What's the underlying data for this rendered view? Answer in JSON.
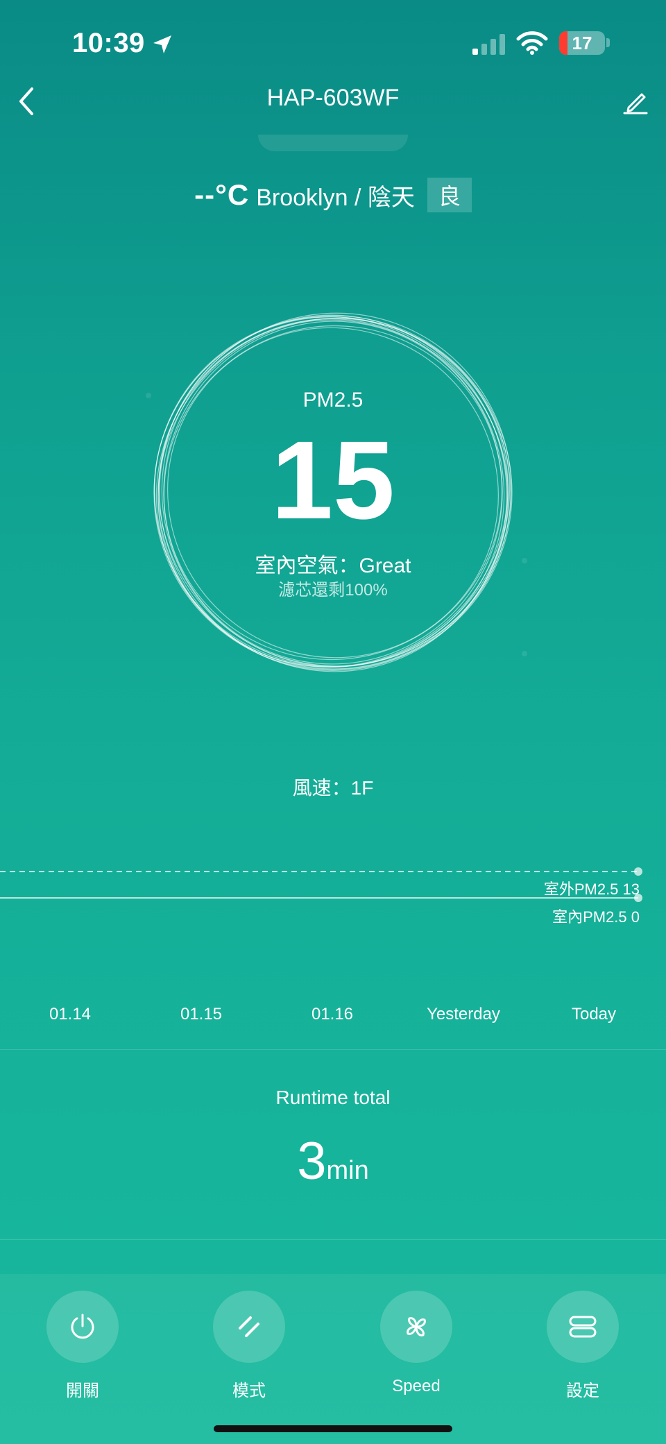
{
  "status_bar": {
    "time": "10:39",
    "battery": "17"
  },
  "nav": {
    "title": "HAP-603WF"
  },
  "weather": {
    "temp": "--°C",
    "city": "Brooklyn / 陰天",
    "aqi": "良"
  },
  "gauge": {
    "label": "PM2.5",
    "value": "15",
    "air_quality": "室內空氣：Great",
    "filter": "濾芯還剩100%"
  },
  "fan_speed": "風速：1F",
  "chart": {
    "outdoor_label": "室外PM2.5 13",
    "indoor_label": "室內PM2.5 0",
    "dates": [
      "01.14",
      "01.15",
      "01.16",
      "Yesterday",
      "Today"
    ]
  },
  "runtime": {
    "label": "Runtime total",
    "value": "3",
    "unit": "min"
  },
  "controls": [
    {
      "label": "開關",
      "icon": "power-icon"
    },
    {
      "label": "模式",
      "icon": "mode-icon"
    },
    {
      "label": "Speed",
      "icon": "fan-icon"
    },
    {
      "label": "設定",
      "icon": "settings-icon"
    }
  ]
}
